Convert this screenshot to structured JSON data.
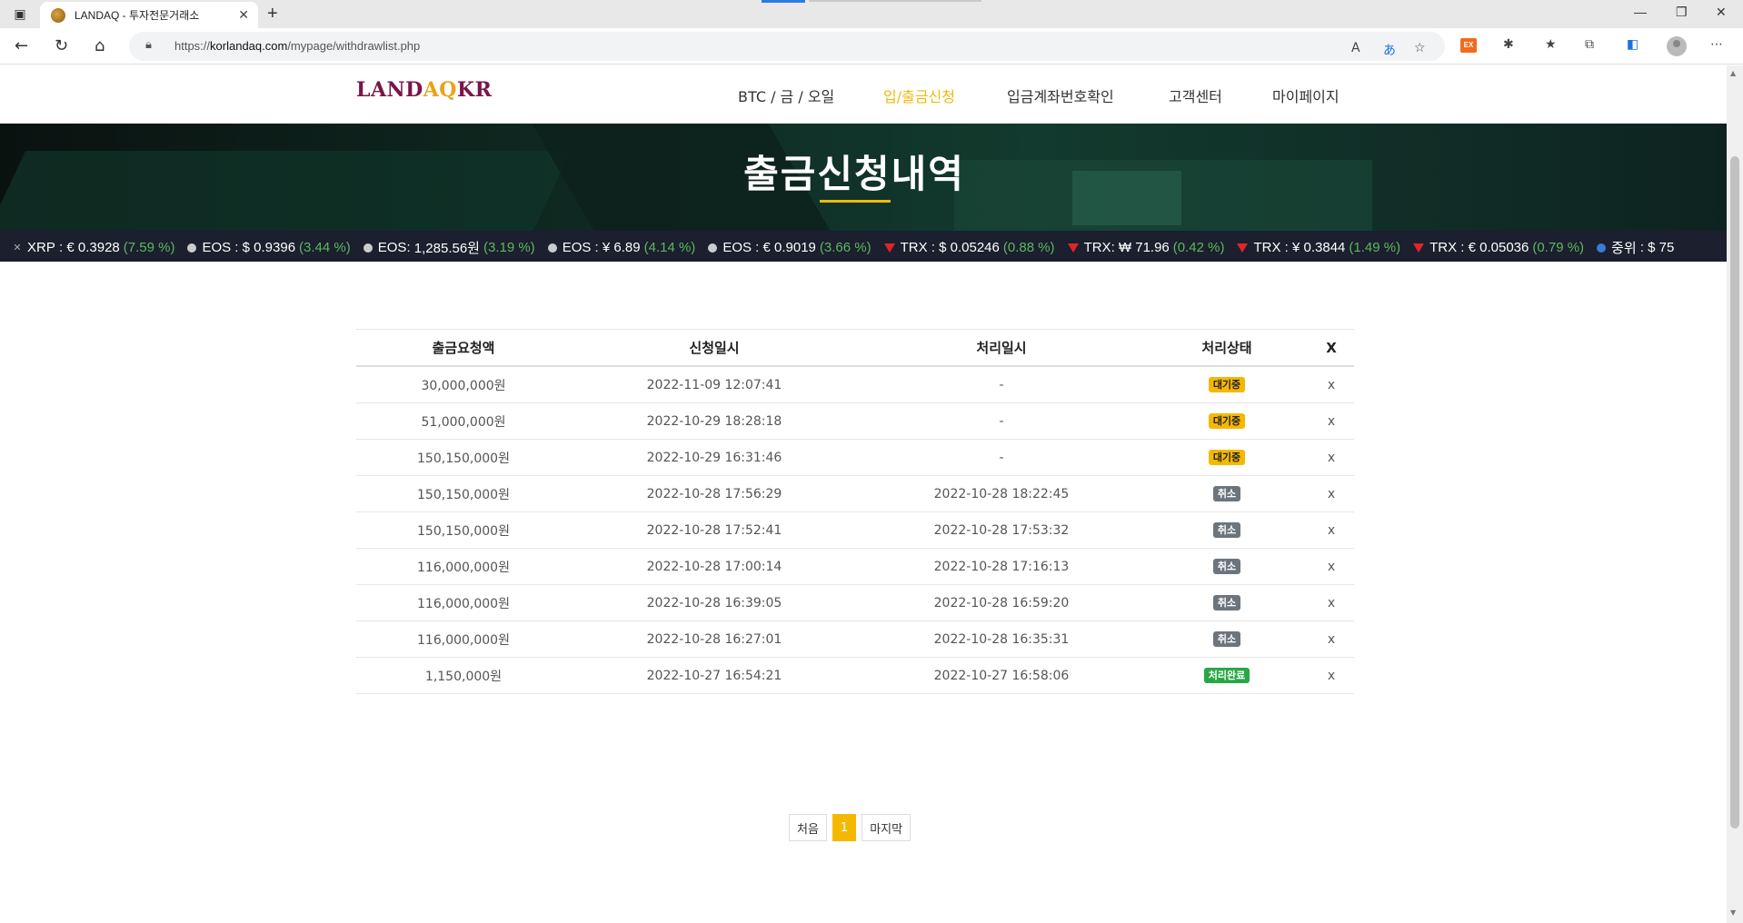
{
  "browser": {
    "tab_title": "LANDAQ - 투자전문거래소",
    "url_prefix": "https://",
    "url_domain": "korlandaq.com",
    "url_path": "/mypage/withdrawlist.php"
  },
  "header": {
    "logo_part1": "LAND",
    "logo_part2": "AQ",
    "logo_part3": "KR",
    "menu": [
      {
        "label": "BTC / 금 / 오일",
        "active": false
      },
      {
        "label": "입/출금신청",
        "active": true
      },
      {
        "label": "입금계좌번호확인",
        "active": false
      },
      {
        "label": "고객센터",
        "active": false
      },
      {
        "label": "마이페이지",
        "active": false
      }
    ],
    "accent_color": "#f0b90b"
  },
  "hero": {
    "title": "출금신청내역"
  },
  "ticker": [
    {
      "icon": "xrp",
      "name": "XRP",
      "price": "€ 0.3928",
      "change": "(7.59 %)",
      "sep": " : "
    },
    {
      "icon": "eos",
      "name": "EOS",
      "price": "$ 0.9396",
      "change": "(3.44 %)",
      "sep": " : "
    },
    {
      "icon": "eos",
      "name": "EOS",
      "price": "1,285.56원",
      "change": "(3.19 %)",
      "sep": ": "
    },
    {
      "icon": "eos",
      "name": "EOS",
      "price": "¥ 6.89",
      "change": "(4.14 %)",
      "sep": " : "
    },
    {
      "icon": "eos",
      "name": "EOS",
      "price": "€ 0.9019",
      "change": "(3.66 %)",
      "sep": " : "
    },
    {
      "icon": "trx",
      "name": "TRX",
      "price": "$ 0.05246",
      "change": "(0.88 %)",
      "sep": " : "
    },
    {
      "icon": "trx",
      "name": "TRX",
      "price": "₩ 71.96",
      "change": "(0.42 %)",
      "sep": ": "
    },
    {
      "icon": "trx",
      "name": "TRX",
      "price": "¥ 0.3844",
      "change": "(1.49 %)",
      "sep": " : "
    },
    {
      "icon": "trx",
      "name": "TRX",
      "price": "€ 0.05036",
      "change": "(0.79 %)",
      "sep": " : "
    },
    {
      "icon": "ltc",
      "name": "중위",
      "price": "$ 75",
      "change": "",
      "sep": " : "
    }
  ],
  "table": {
    "headers": [
      "출금요청액",
      "신청일시",
      "처리일시",
      "처리상태",
      "X"
    ],
    "rows": [
      {
        "amount": "30,000,000원",
        "requested": "2022-11-09 12:07:41",
        "processed": "-",
        "status": "대기중",
        "status_type": "wait",
        "action": "x"
      },
      {
        "amount": "51,000,000원",
        "requested": "2022-10-29 18:28:18",
        "processed": "-",
        "status": "대기중",
        "status_type": "wait",
        "action": "x"
      },
      {
        "amount": "150,150,000원",
        "requested": "2022-10-29 16:31:46",
        "processed": "-",
        "status": "대기중",
        "status_type": "wait",
        "action": "x"
      },
      {
        "amount": "150,150,000원",
        "requested": "2022-10-28 17:56:29",
        "processed": "2022-10-28 18:22:45",
        "status": "취소",
        "status_type": "cancel",
        "action": "x"
      },
      {
        "amount": "150,150,000원",
        "requested": "2022-10-28 17:52:41",
        "processed": "2022-10-28 17:53:32",
        "status": "취소",
        "status_type": "cancel",
        "action": "x"
      },
      {
        "amount": "116,000,000원",
        "requested": "2022-10-28 17:00:14",
        "processed": "2022-10-28 17:16:13",
        "status": "취소",
        "status_type": "cancel",
        "action": "x"
      },
      {
        "amount": "116,000,000원",
        "requested": "2022-10-28 16:39:05",
        "processed": "2022-10-28 16:59:20",
        "status": "취소",
        "status_type": "cancel",
        "action": "x"
      },
      {
        "amount": "116,000,000원",
        "requested": "2022-10-28 16:27:01",
        "processed": "2022-10-28 16:35:31",
        "status": "취소",
        "status_type": "cancel",
        "action": "x"
      },
      {
        "amount": "1,150,000원",
        "requested": "2022-10-27 16:54:21",
        "processed": "2022-10-27 16:58:06",
        "status": "처리완료",
        "status_type": "done",
        "action": "x"
      }
    ]
  },
  "pagination": {
    "first": "처음",
    "current": "1",
    "last": "마지막"
  }
}
